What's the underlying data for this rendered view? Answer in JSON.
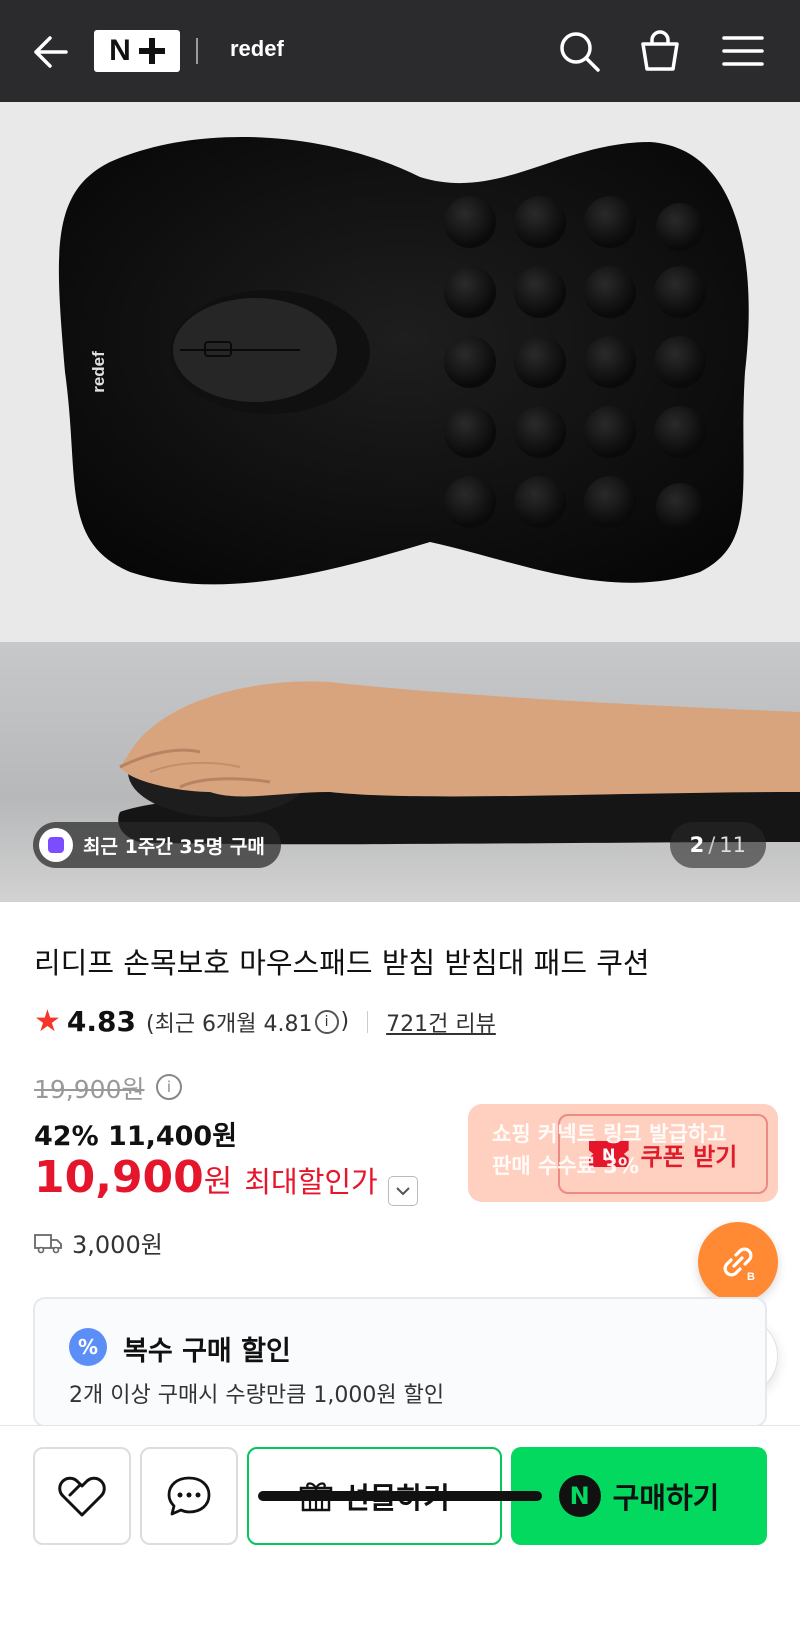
{
  "header": {
    "logo_text": "N+",
    "brand": "redef"
  },
  "gallery": {
    "product_imprint": "redef",
    "purchase_badge": "최근 1주간 35명 구매",
    "current_page": "2",
    "page_separator": "/",
    "total_pages": "11"
  },
  "product": {
    "title": "리디프 손목보호 마우스패드 받침 받침대 패드 쿠션",
    "rating": {
      "score": "4.83",
      "recent_prefix": "(최근 6개월 4.81",
      "info_glyph": "i",
      "recent_suffix": ")",
      "reviews": "721건 리뷰"
    },
    "price": {
      "original": "19,900원",
      "discount_line": "42% 11,400원",
      "final_amount": "10,900",
      "final_unit": "원",
      "max_discount_label": "최대할인가"
    },
    "shipping_fee": "3,000원"
  },
  "coupon": {
    "tooltip_line1": "쇼핑 커넥트 링크 발급하고",
    "tooltip_line2": "판매 수수료 3%",
    "button_label": "쿠폰 받기",
    "ticket_letter": "N"
  },
  "multi_purchase": {
    "badge": "%",
    "title": "복수 구매 할인",
    "description": "2개 이상 구매시 수량만큼 1,000원 할인"
  },
  "bottom_bar": {
    "gift_label": "선물하기",
    "buy_label": "구매하기",
    "buy_badge": "N"
  },
  "colors": {
    "header_bg": "#2b2b2e",
    "price_red": "#e5162b",
    "naver_green": "#03d85f",
    "link_orange": "#ff8a33"
  }
}
